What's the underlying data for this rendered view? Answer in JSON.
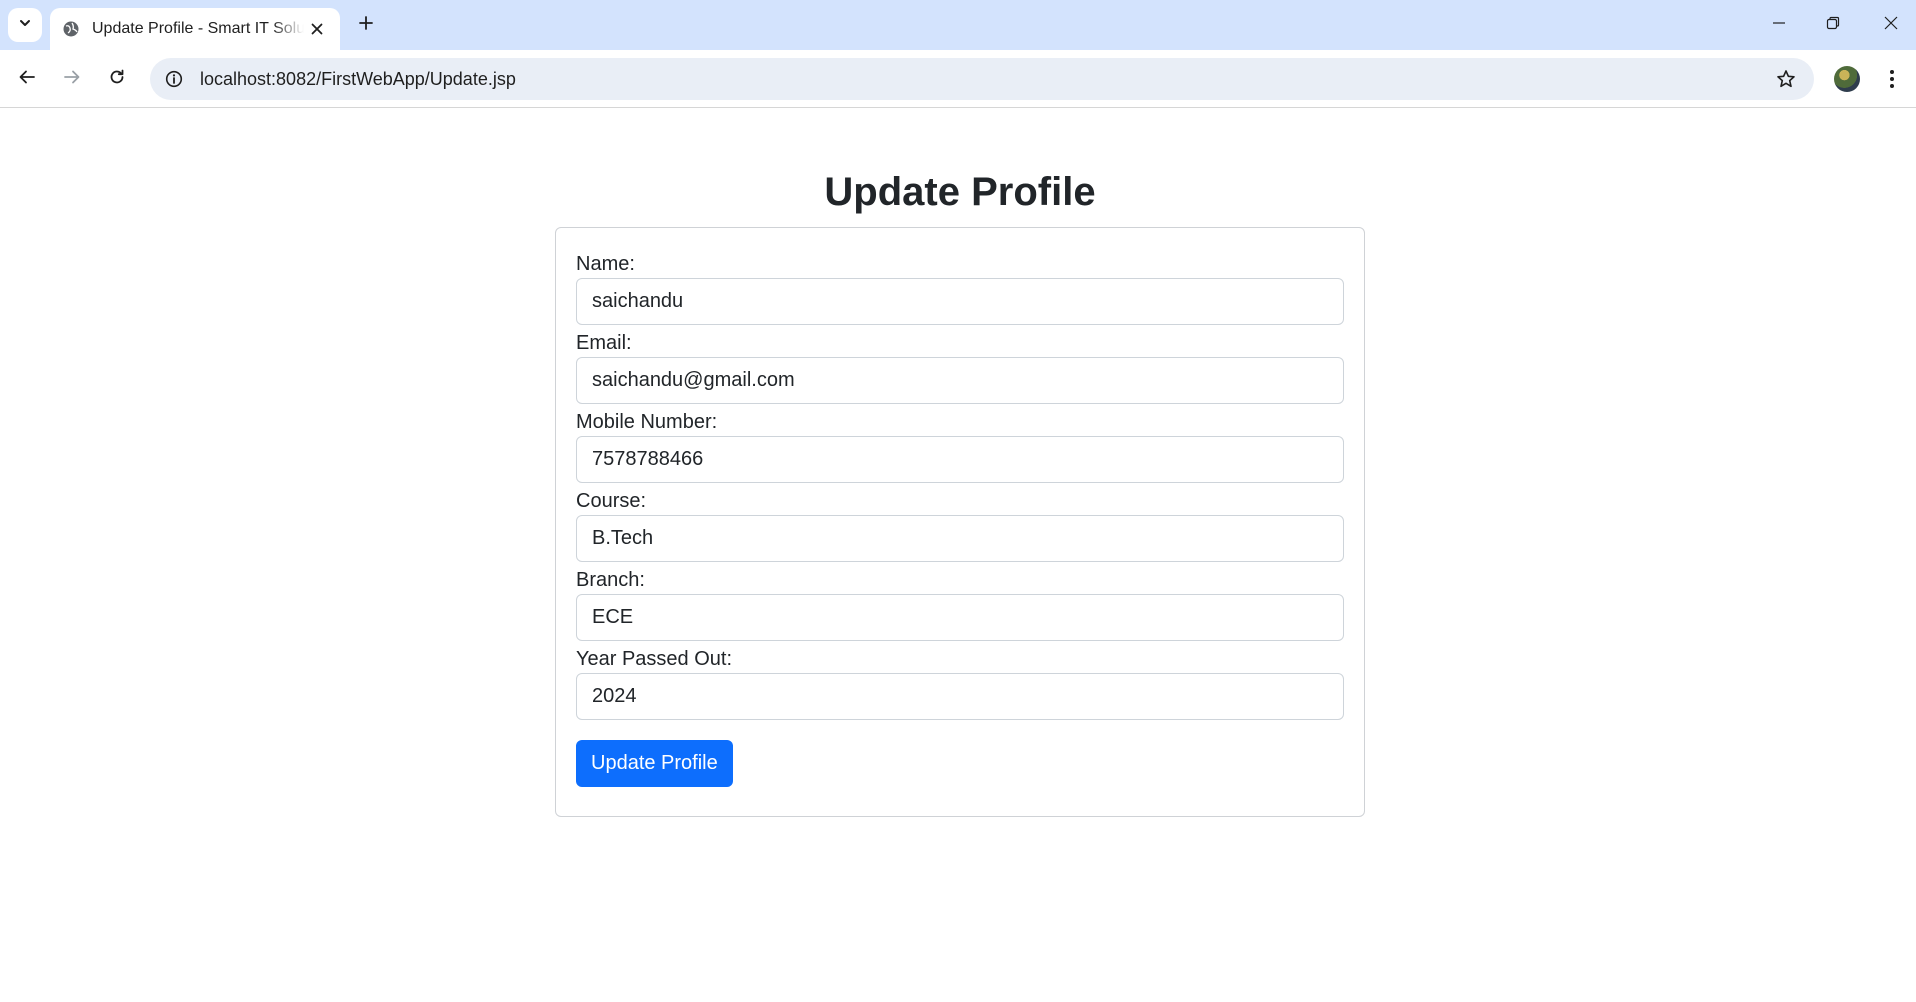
{
  "browser": {
    "tab_title": "Update Profile - Smart IT Solutions",
    "url": "localhost:8082/FirstWebApp/Update.jsp"
  },
  "page": {
    "title": "Update Profile"
  },
  "form": {
    "fields": [
      {
        "label": "Name:",
        "value": "saichandu"
      },
      {
        "label": "Email:",
        "value": "saichandu@gmail.com"
      },
      {
        "label": "Mobile Number:",
        "value": "7578788466"
      },
      {
        "label": "Course:",
        "value": "B.Tech"
      },
      {
        "label": "Branch:",
        "value": "ECE"
      },
      {
        "label": "Year Passed Out:",
        "value": "2024"
      }
    ],
    "submit_label": "Update Profile"
  },
  "colors": {
    "tabstrip": "#d3e3fd",
    "omnibox": "#e9eef6",
    "primary_button": "#0d6efd"
  },
  "icons": {
    "tab_search": "chevron-down-icon",
    "favicon": "globe-icon",
    "tab_close": "close-icon",
    "new_tab": "plus-icon",
    "back": "arrow-left-icon",
    "forward": "arrow-right-icon",
    "reload": "reload-icon",
    "site_info": "info-icon",
    "bookmark": "star-icon",
    "menu": "kebab-menu-icon"
  }
}
